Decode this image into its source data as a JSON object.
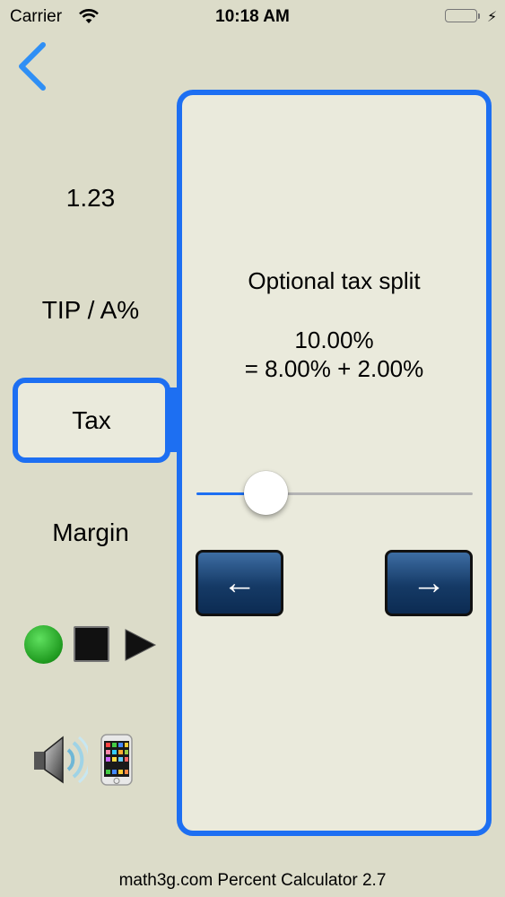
{
  "status_bar": {
    "carrier": "Carrier",
    "time": "10:18 AM",
    "battery_color": "#4cd964"
  },
  "nav": {
    "back_icon": "chevron-left-icon"
  },
  "sidebar": {
    "value": "1.23",
    "tip_label": "TIP / A%",
    "tax_label": "Tax",
    "margin_label": "Margin"
  },
  "panel": {
    "title": "Optional tax split",
    "total": "10.00%",
    "split": "= 8.00% + 2.00%",
    "slider_fraction": 0.25,
    "prev_label": "←",
    "next_label": "→"
  },
  "controls": {
    "record_icon": "green-record-icon",
    "stop_icon": "stop-icon",
    "play_icon": "play-icon",
    "speaker_icon": "speaker-icon",
    "phone_icon": "phone-icon"
  },
  "footer": {
    "text": "math3g.com  Percent Calculator 2.7"
  },
  "colors": {
    "accent": "#1d6ff2",
    "background": "#dcdcc9",
    "panel": "#eaeadc"
  }
}
